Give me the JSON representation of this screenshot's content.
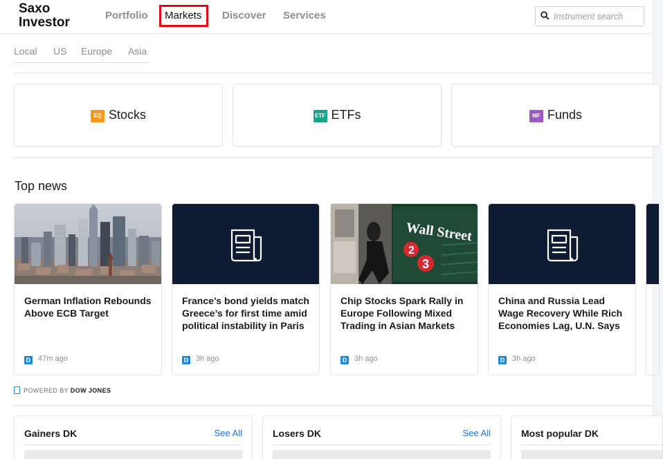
{
  "header": {
    "logo_line1": "Saxo",
    "logo_line2": "Investor",
    "nav": [
      "Portfolio",
      "Markets",
      "Discover",
      "Services"
    ],
    "search_placeholder": "Instrument search"
  },
  "regions": [
    "Local",
    "US",
    "Europe",
    "Asia"
  ],
  "categories": [
    {
      "label": "Stocks",
      "badge": "EQ",
      "color": "#f39a1e"
    },
    {
      "label": "ETFs",
      "badge": "ETF",
      "color": "#1aa28a"
    },
    {
      "label": "Funds",
      "badge": "MF",
      "color": "#9b59c6"
    }
  ],
  "top_news": {
    "title": "Top news",
    "items": [
      {
        "title": "German Inflation Rebounds Above ECB Target",
        "source_badge": "D",
        "time": "47m ago"
      },
      {
        "title": "France’s bond yields match Greece’s for first time amid political instability in Paris",
        "source_badge": "D",
        "time": "3h ago"
      },
      {
        "title": "Chip Stocks Spark Rally in Europe Following Mixed Trading in Asian Markets",
        "source_badge": "D",
        "time": "3h ago"
      },
      {
        "title": "China and Russia Lead Wage Recovery While Rich Economies Lag, U.N. Says",
        "source_badge": "D",
        "time": "3h ago"
      }
    ],
    "image_texts": {
      "street_sign": "Wall Street",
      "numbers": [
        "2",
        "3"
      ]
    },
    "powered_prefix": "POWERED BY",
    "powered_brand": "DOW JONES"
  },
  "panels": [
    {
      "title": "Gainers DK",
      "see_all": "See All"
    },
    {
      "title": "Losers DK",
      "see_all": "See All"
    },
    {
      "title": "Most popular DK",
      "see_all": ""
    }
  ],
  "colors": {
    "accent": "#1e73d6",
    "active_highlight": "#e30613",
    "news_dark": "#0f1b33"
  }
}
